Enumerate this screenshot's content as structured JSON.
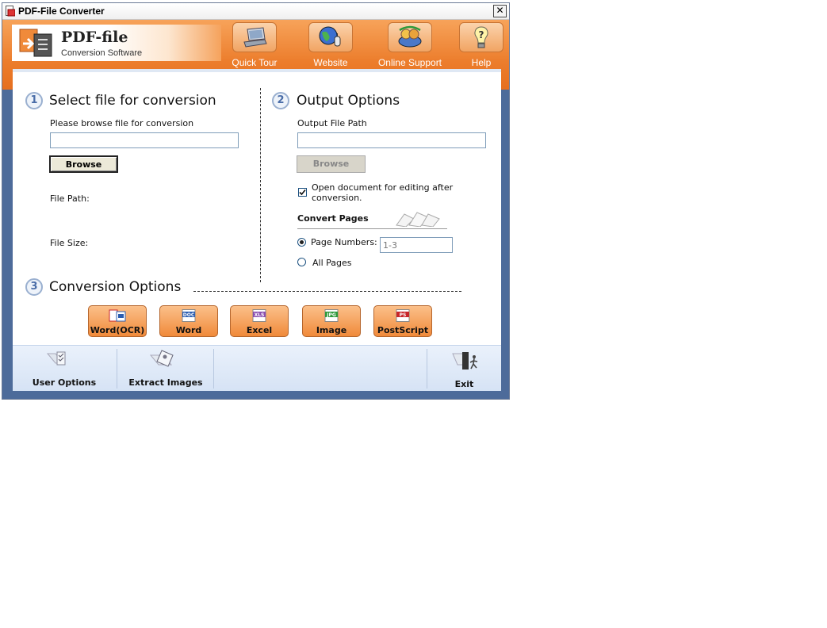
{
  "window": {
    "title": "PDF-File Converter",
    "close_glyph": "✕"
  },
  "logo": {
    "title": "PDF-file",
    "subtitle": "Conversion Software"
  },
  "toolbar": [
    {
      "label": "Quick Tour",
      "icon": "laptop-icon"
    },
    {
      "label": "Website",
      "icon": "globe-icon"
    },
    {
      "label": "Online Support",
      "icon": "support-icon"
    },
    {
      "label": "Help",
      "icon": "help-bulb-icon"
    }
  ],
  "step1": {
    "num": "1",
    "title": "Select file for conversion",
    "browse_label": "Please browse file for conversion",
    "input_value": "",
    "browse_button": "Browse",
    "file_path_label": "File Path:",
    "file_size_label": "File Size:"
  },
  "step2": {
    "num": "2",
    "title": "Output Options",
    "output_path_label": "Output File Path",
    "input_value": "",
    "browse_button": "Browse",
    "open_doc_label": "Open document for editing after conversion.",
    "open_doc_checked": true,
    "convert_pages_label": "Convert Pages",
    "page_numbers_label": "Page Numbers:",
    "page_numbers_placeholder": "1-3",
    "all_pages_label": "All Pages",
    "selected": "page_numbers"
  },
  "step3": {
    "num": "3",
    "title": "Conversion Options",
    "buttons": [
      {
        "label": "Word(OCR)",
        "badge": "",
        "color": "#2b5db0"
      },
      {
        "label": "Word",
        "badge": "DOC",
        "color": "#2b5db0"
      },
      {
        "label": "Excel",
        "badge": "XLS",
        "color": "#8a4fb0"
      },
      {
        "label": "Image",
        "badge": "JPG",
        "color": "#2f9a3a"
      },
      {
        "label": "PostScript",
        "badge": "PS",
        "color": "#c8252a"
      }
    ]
  },
  "bottom": {
    "user_options": "User Options",
    "extract_images": "Extract Images",
    "exit": "Exit"
  },
  "colors": {
    "accent_orange": "#ec7d2c",
    "frame_blue": "#4d6b9a"
  }
}
